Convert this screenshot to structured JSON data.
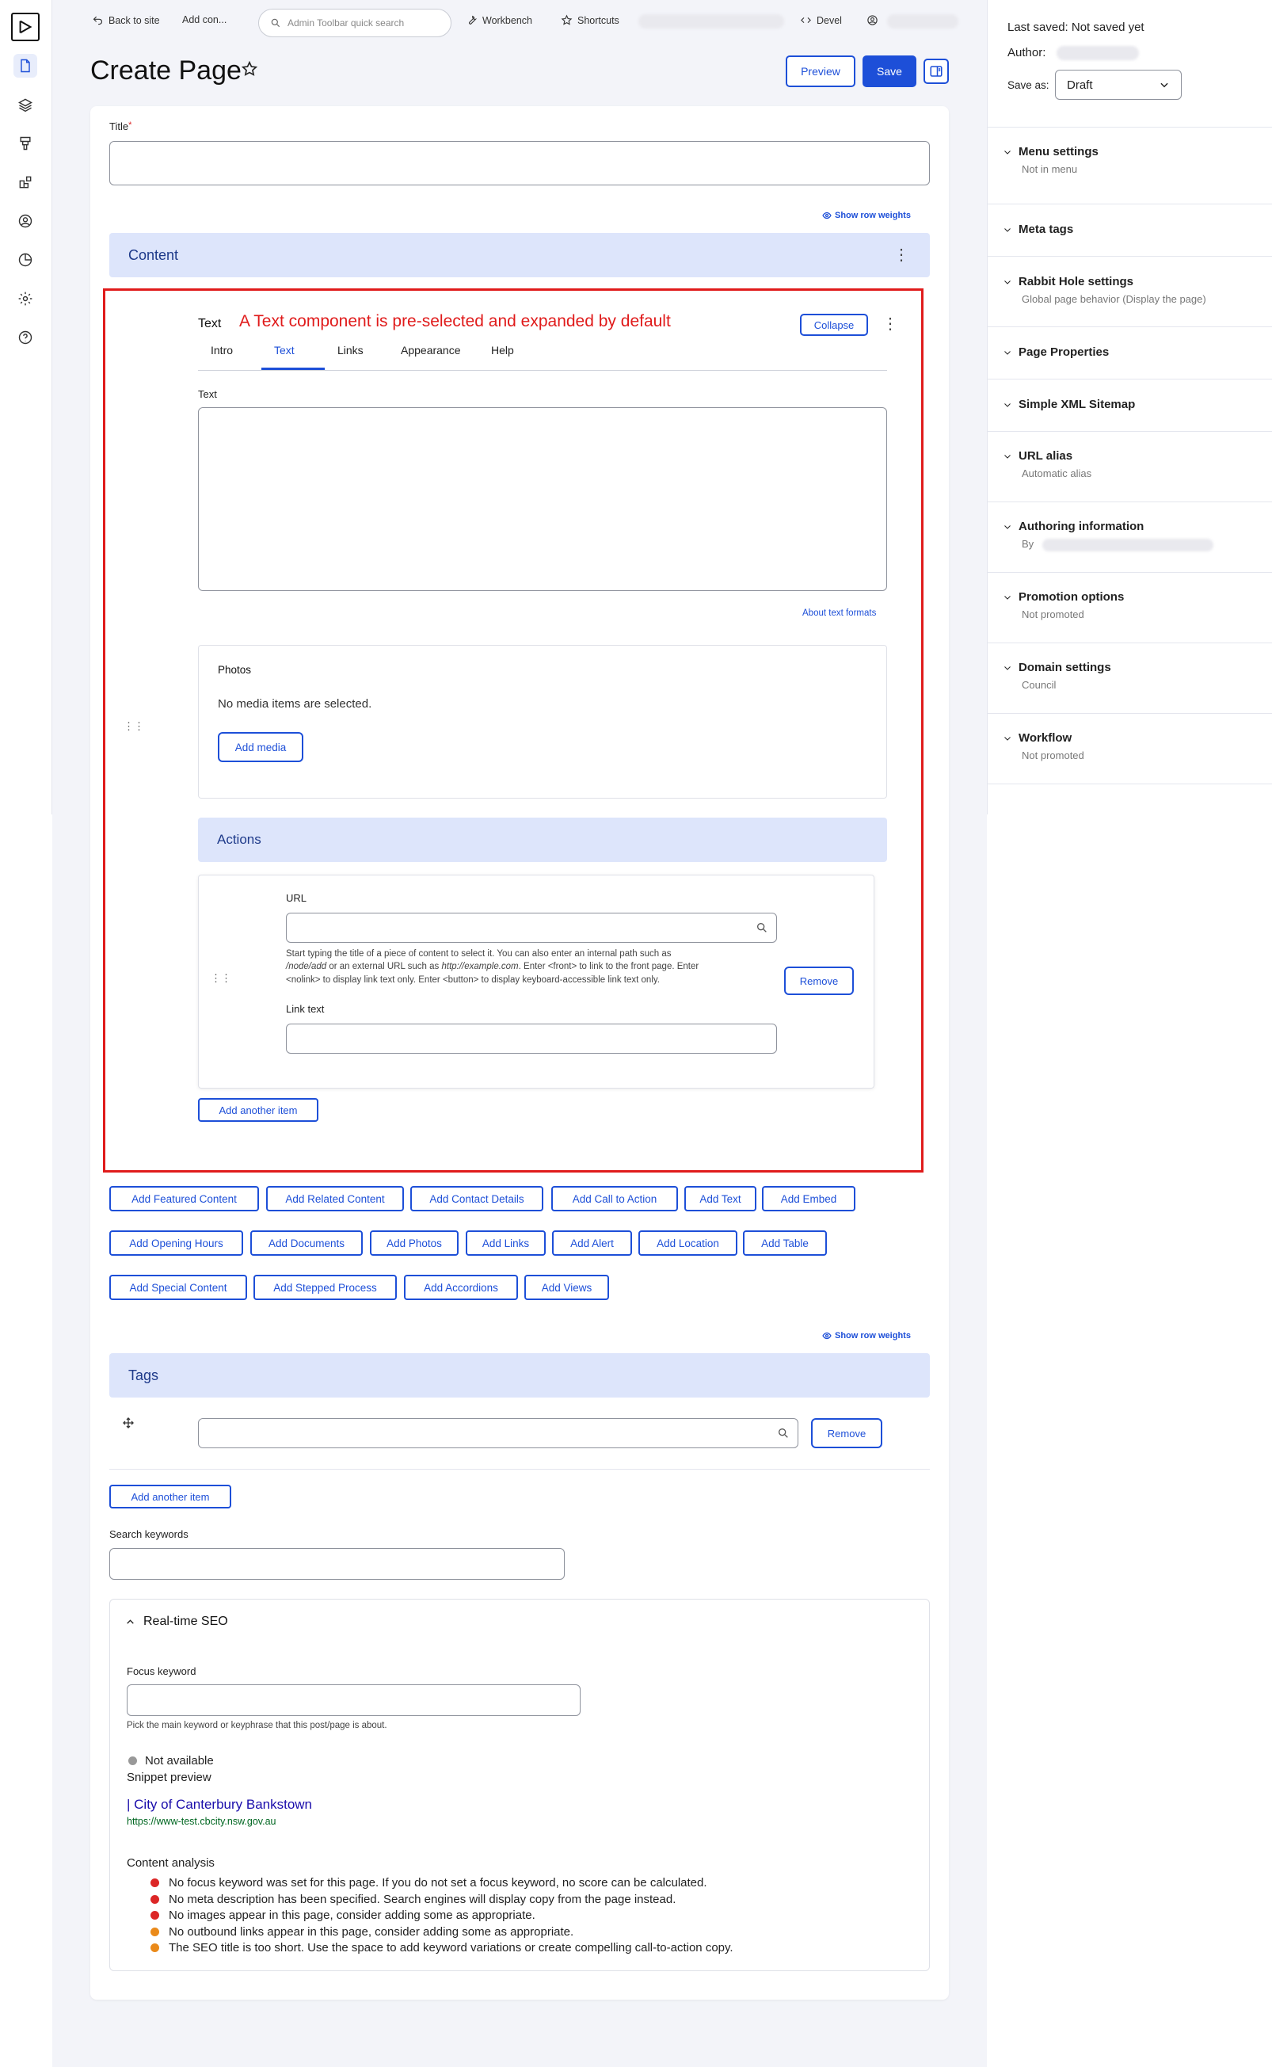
{
  "toolbar": {
    "back_label": "Back to site",
    "add_content_label": "Add con...",
    "search_placeholder": "Admin Toolbar quick search",
    "workbench_label": "Workbench",
    "shortcuts_label": "Shortcuts",
    "devel_label": "Devel"
  },
  "header": {
    "title": "Create Page",
    "preview_label": "Preview",
    "save_label": "Save"
  },
  "title_field": {
    "label": "Title",
    "required_mark": "*"
  },
  "show_row_weights": "Show row weights",
  "content_section": {
    "title": "Content"
  },
  "annotation": "A Text component is pre-selected and expanded by default",
  "component": {
    "name": "Text",
    "collapse_label": "Collapse",
    "tabs": [
      "Intro",
      "Text",
      "Links",
      "Appearance",
      "Help"
    ],
    "text_label": "Text",
    "about_formats": "About text formats",
    "photos_title": "Photos",
    "no_media": "No media items are selected.",
    "add_media": "Add media",
    "actions_title": "Actions",
    "url_label": "URL",
    "url_help_1": "Start typing the title of a piece of content to select it. You can also enter an internal path such as",
    "url_help_2_em1": "/node/add",
    "url_help_2_mid": " or an external URL such as ",
    "url_help_2_em2": "http://example.com",
    "url_help_2_end": ". Enter <front> to link to the front page. Enter",
    "url_help_3": "<nolink> to display link text only. Enter <button> to display keyboard-accessible link text only.",
    "remove_label": "Remove",
    "link_text_label": "Link text",
    "add_another": "Add another item"
  },
  "add_buttons": [
    [
      "Add Featured Content",
      "Add Related Content",
      "Add Contact Details",
      "Add Call to Action",
      "Add Text",
      "Add Embed"
    ],
    [
      "Add Opening Hours",
      "Add Documents",
      "Add Photos",
      "Add Links",
      "Add Alert",
      "Add Location",
      "Add Table"
    ],
    [
      "Add Special Content",
      "Add Stepped Process",
      "Add Accordions",
      "Add Views"
    ]
  ],
  "tags": {
    "title": "Tags",
    "remove_label": "Remove",
    "add_another": "Add another item"
  },
  "search_keywords": {
    "label": "Search keywords"
  },
  "seo": {
    "title": "Real-time SEO",
    "focus_label": "Focus keyword",
    "focus_help": "Pick the main keyword or keyphrase that this post/page is about.",
    "status": "Not available",
    "snippet_label": "Snippet preview",
    "snippet_title": "| City of Canterbury Bankstown",
    "snippet_url": "https://www-test.cbcity.nsw.gov.au",
    "analysis_label": "Content analysis",
    "analysis": [
      {
        "text": "No focus keyword was set for this page. If you do not set a focus keyword, no score can be calculated.",
        "color": "#dc2626"
      },
      {
        "text": "No meta description has been specified. Search engines will display copy from the page instead.",
        "color": "#dc2626"
      },
      {
        "text": "No images appear in this page, consider adding some as appropriate.",
        "color": "#dc2626"
      },
      {
        "text": "No outbound links appear in this page, consider adding some as appropriate.",
        "color": "#ea8a1a"
      },
      {
        "text": "The SEO title is too short. Use the space to add keyword variations or create compelling call-to-action copy.",
        "color": "#ea8a1a"
      }
    ]
  },
  "right_panel": {
    "last_saved": "Last saved: Not saved yet",
    "author_label": "Author:",
    "save_as_label": "Save as:",
    "save_as_value": "Draft",
    "sections": [
      {
        "title": "Menu settings",
        "sub": "Not in menu"
      },
      {
        "title": "Meta tags",
        "sub": ""
      },
      {
        "title": "Rabbit Hole settings",
        "sub": "Global page behavior (Display the page)"
      },
      {
        "title": "Page Properties",
        "sub": ""
      },
      {
        "title": "Simple XML Sitemap",
        "sub": ""
      },
      {
        "title": "URL alias",
        "sub": "Automatic alias"
      },
      {
        "title": "Authoring information",
        "sub": "By"
      },
      {
        "title": "Promotion options",
        "sub": "Not promoted"
      },
      {
        "title": "Domain settings",
        "sub": "Council"
      },
      {
        "title": "Workflow",
        "sub": "Not promoted"
      }
    ]
  },
  "colors": {
    "accent": "#1d4fd8",
    "section_bg": "#dde5fb",
    "annotation_red": "#e01b1b"
  }
}
